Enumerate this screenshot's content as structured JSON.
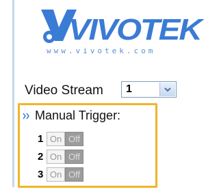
{
  "logo": {
    "wordmark": "VIVOTEK",
    "url": "www.vivotek.com",
    "brand_color": "#3a7bd5"
  },
  "stream": {
    "label": "Video Stream",
    "selected": "1"
  },
  "manual_trigger": {
    "title": "Manual Trigger:",
    "highlight_color": "#f0b429",
    "rows": [
      {
        "number": "1",
        "on_label": "On",
        "off_label": "Off"
      },
      {
        "number": "2",
        "on_label": "On",
        "off_label": "Off"
      },
      {
        "number": "3",
        "on_label": "On",
        "off_label": "Off"
      }
    ]
  }
}
